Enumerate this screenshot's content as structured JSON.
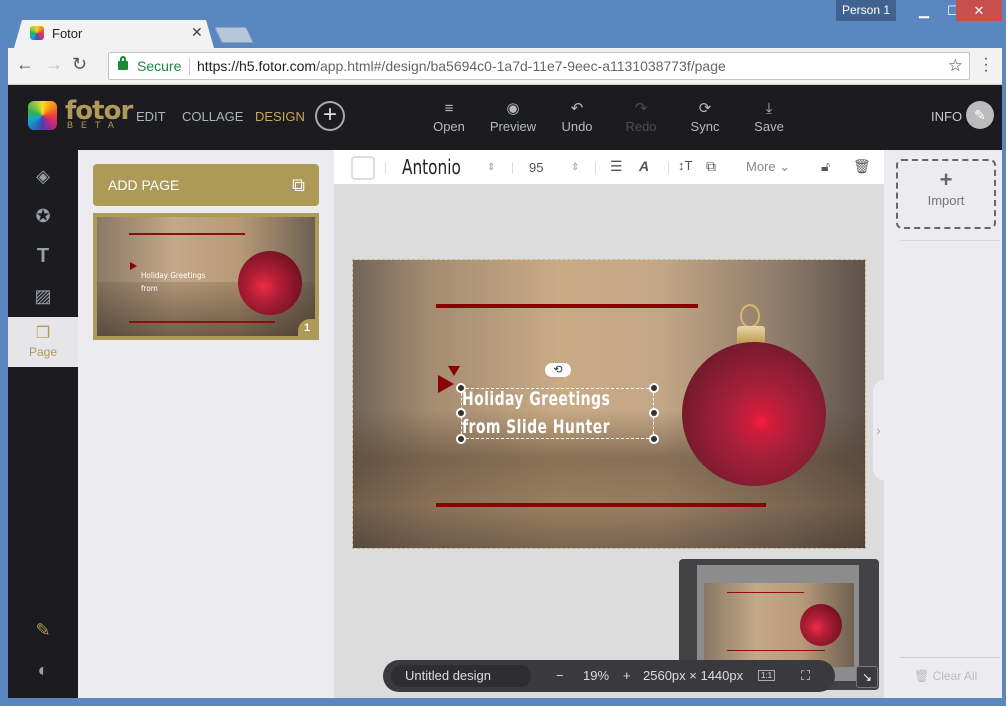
{
  "browser": {
    "profile": "Person 1",
    "tab_title": "Fotor",
    "secure_label": "Secure",
    "url_host": "https://h5.fotor.com",
    "url_path": "/app.html#/design/ba5694c0-1a7d-11e7-9eec-a1131038773f/page"
  },
  "app": {
    "logo_text": "fotor",
    "logo_beta": "BETA",
    "nav": [
      {
        "label": "EDIT"
      },
      {
        "label": "COLLAGE"
      },
      {
        "label": "DESIGN"
      }
    ],
    "actions": [
      {
        "label": "Open",
        "icon": "≡"
      },
      {
        "label": "Preview",
        "icon": "◉"
      },
      {
        "label": "Undo",
        "icon": "↶"
      },
      {
        "label": "Redo",
        "icon": "↷"
      },
      {
        "label": "Sync",
        "icon": "⟳"
      },
      {
        "label": "Save",
        "icon": "⤓"
      }
    ],
    "info_label": "INFO",
    "accent_color": "#ad9a57"
  },
  "sidebar": {
    "page_label": "Page"
  },
  "pages_panel": {
    "add_page_label": "ADD PAGE",
    "thumb_text_1": "Holiday Greetings",
    "thumb_text_2": "from",
    "page_number": "1"
  },
  "text_toolbar": {
    "font": "Antonio",
    "size": "95",
    "more_label": "More"
  },
  "design": {
    "text_line1": "Holiday Greetings",
    "text_line2": "from Slide Hunter"
  },
  "zoombar": {
    "design_name": "Untitled design",
    "minus": "−",
    "zoom": "19%",
    "plus": "+",
    "dimensions": "2560px × 1440px",
    "actual_size_label": "1:1"
  },
  "right_panel": {
    "import_label": "Import",
    "clear_all_label": "Clear All"
  }
}
